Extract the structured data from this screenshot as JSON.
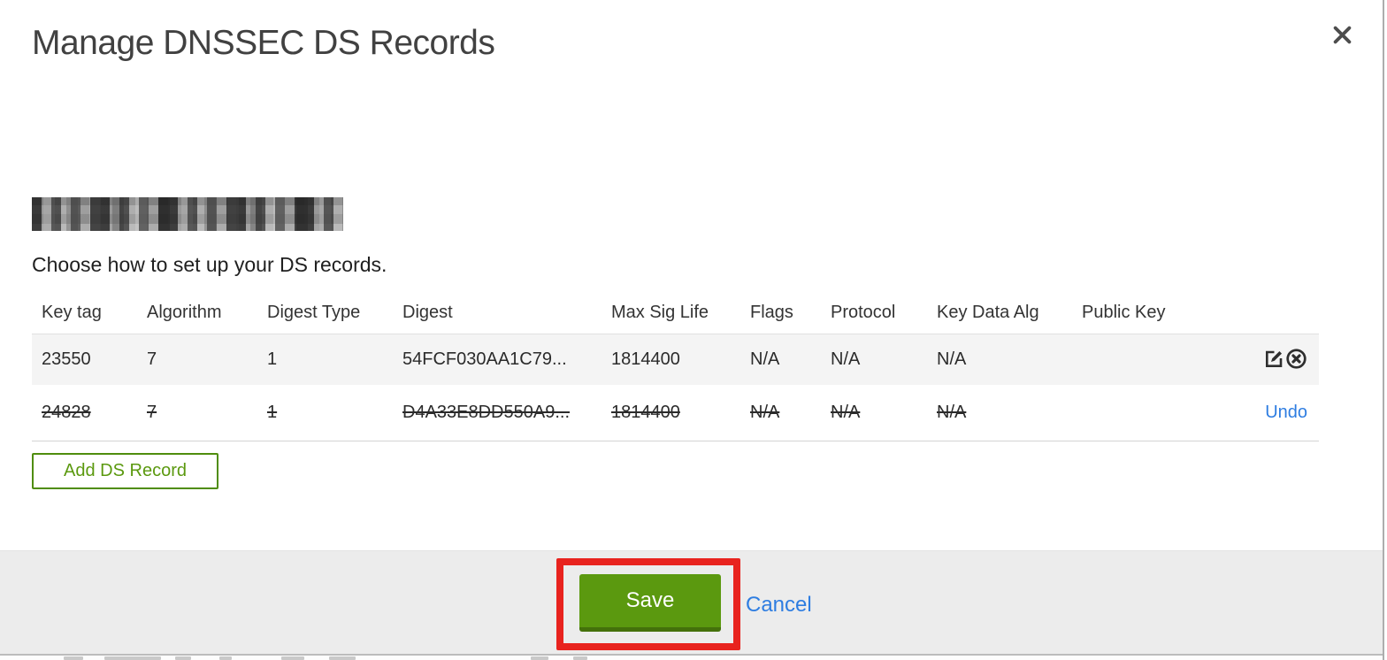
{
  "dialog": {
    "title": "Manage DNSSEC DS Records",
    "instruction": "Choose how to set up your DS records.",
    "domain": {
      "redacted": true
    },
    "add_record_button": "Add DS Record",
    "footer": {
      "save": "Save",
      "cancel": "Cancel"
    }
  },
  "table": {
    "headers": [
      "Key tag",
      "Algorithm",
      "Digest Type",
      "Digest",
      "Max Sig Life",
      "Flags",
      "Protocol",
      "Key Data Alg",
      "Public Key"
    ],
    "rows": [
      {
        "key_tag": "23550",
        "algorithm": "7",
        "digest_type": "1",
        "digest": "54FCF030AA1C79...",
        "max_sig_life": "1814400",
        "flags": "N/A",
        "protocol": "N/A",
        "key_data_alg": "N/A",
        "public_key": "",
        "state": "active",
        "actions": [
          "edit",
          "delete"
        ]
      },
      {
        "key_tag": "24828",
        "algorithm": "7",
        "digest_type": "1",
        "digest": "D4A33E8DD550A9...",
        "max_sig_life": "1814400",
        "flags": "N/A",
        "protocol": "N/A",
        "key_data_alg": "N/A",
        "public_key": "",
        "state": "marked-for-deletion",
        "undo_label": "Undo"
      }
    ]
  },
  "icons": [
    "close-icon",
    "edit-icon",
    "delete-circle-x-icon"
  ],
  "colors": {
    "accent_green": "#5b990f",
    "accent_green_dark": "#44710b",
    "link_blue": "#2e7de1",
    "annotation_red": "#e8231e",
    "footer_bg": "#ececec",
    "row_highlight_bg": "#f4f4f4"
  },
  "annotation": {
    "type": "highlight-box",
    "target": "save-button"
  }
}
